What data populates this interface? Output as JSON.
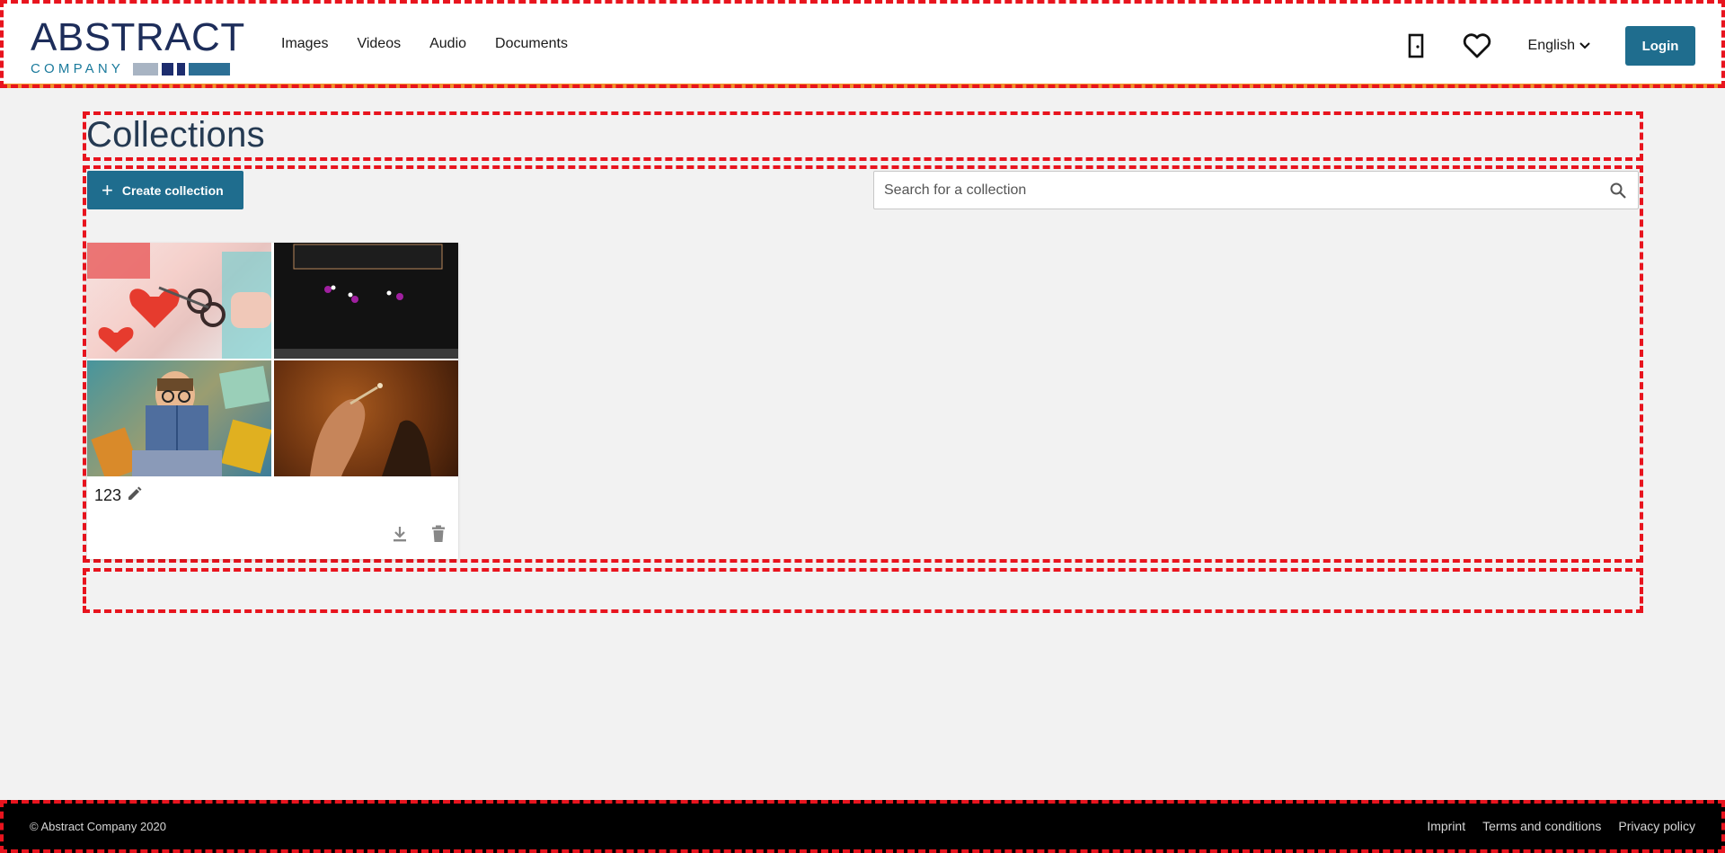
{
  "header": {
    "logo": {
      "word_top": "ABSTRACT",
      "word_bottom": "COMPANY",
      "blocks": [
        "#a8b4c3",
        "#1d2d6e",
        "#1d2d6e",
        "#2c6f95"
      ]
    },
    "nav": [
      "Images",
      "Videos",
      "Audio",
      "Documents"
    ],
    "icons": {
      "door": "door-icon",
      "favorites": "heart-icon",
      "chevron": "chevron-down-icon"
    },
    "language": "English",
    "login_label": "Login",
    "accent_color": "#f0912d",
    "brand_color": "#1f6d8e"
  },
  "page": {
    "title": "Collections"
  },
  "toolbar": {
    "create_label": "Create collection",
    "search_placeholder": "Search for a collection"
  },
  "collections": [
    {
      "name": "123",
      "thumbnails": [
        "crafting-hearts-photo",
        "dark-video-frame",
        "man-with-books-photo",
        "hand-holding-object-photo"
      ],
      "actions": [
        "download-icon",
        "delete-icon"
      ]
    }
  ],
  "footer": {
    "copyright": "© Abstract Company 2020",
    "links": [
      "Imprint",
      "Terms and conditions",
      "Privacy policy"
    ]
  }
}
